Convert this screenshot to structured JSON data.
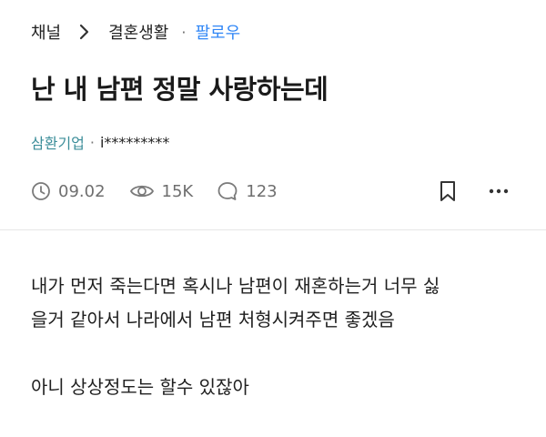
{
  "breadcrumb": {
    "channel": "채널",
    "board": "결혼생활",
    "separator_dot": "·",
    "follow": "팔로우"
  },
  "post": {
    "title": "난 내 남편 정말 사랑하는데",
    "company": "삼환기업",
    "author_separator": "·",
    "author_id": "i*********"
  },
  "stats": {
    "date": "09.02",
    "views": "15K",
    "comments": "123"
  },
  "body": {
    "line1": "내가 먼저 죽는다면 혹시나 남편이 재혼하는거 너무 싫",
    "line2": "을거 같아서 나라에서 남편 처형시켜주면 좋겠음",
    "line3": "아니 상상정도는 할수 있잖아"
  },
  "colors": {
    "follow": "#2f86f6",
    "company": "#3b8d99",
    "meta": "#6f6f6f",
    "divider": "#e6e6e6"
  },
  "icons": {
    "chevron": "chevron-right-icon",
    "clock": "clock-icon",
    "views": "eye-icon",
    "comments": "comment-icon",
    "bookmark": "bookmark-icon",
    "more": "more-icon"
  }
}
